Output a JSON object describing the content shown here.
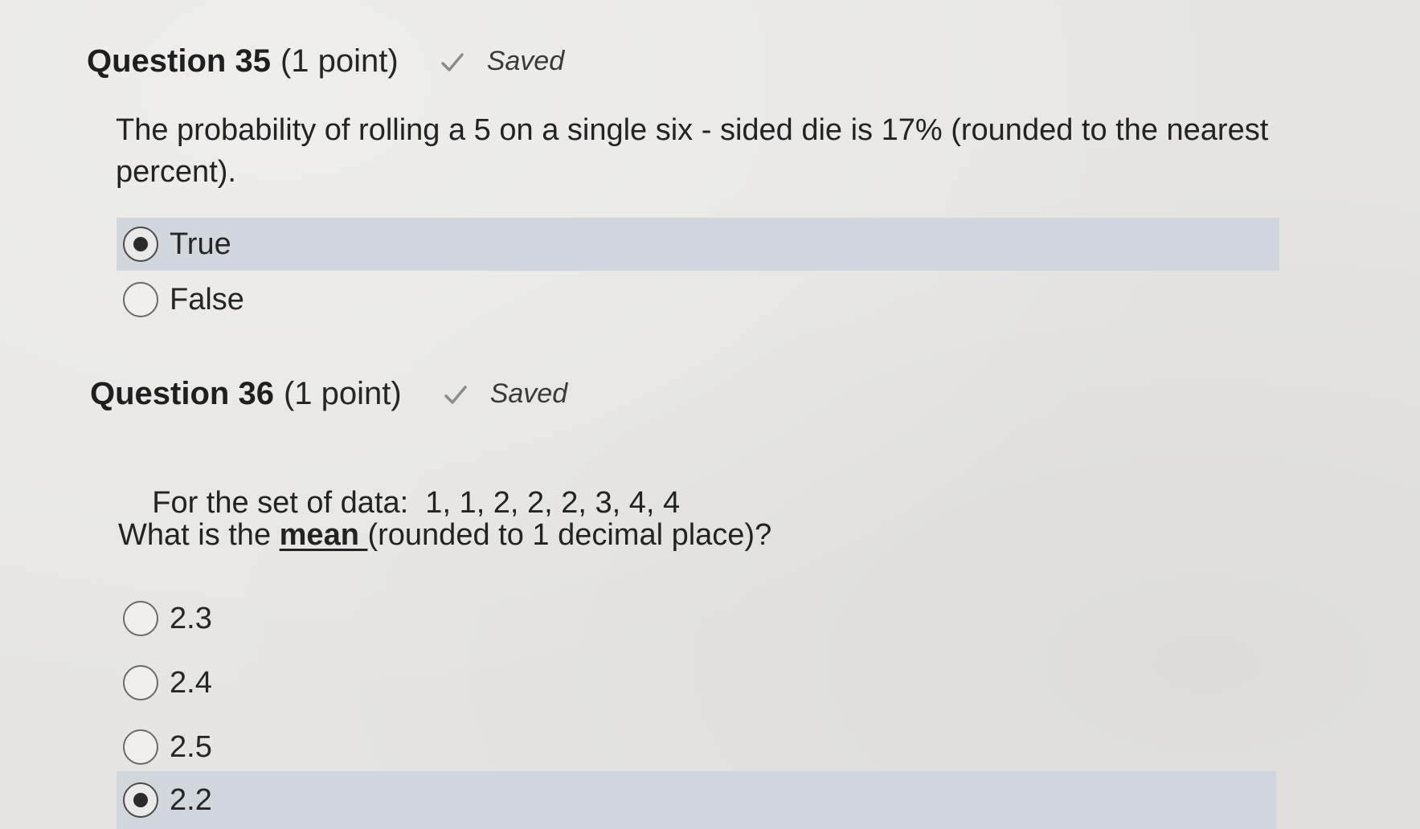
{
  "questions": [
    {
      "title": "Question 35",
      "points": "(1 point)",
      "status": "Saved",
      "status_icon": "check-icon",
      "prompt_lines": [
        "The probability of rolling a 5 on a single six - sided die is 17% (rounded to the nearest",
        "percent)."
      ],
      "options": [
        {
          "label": "True",
          "selected": true
        },
        {
          "label": "False",
          "selected": false
        }
      ]
    },
    {
      "title": "Question 36",
      "points": "(1 point)",
      "status": "Saved",
      "status_icon": "check-icon",
      "data_line": "For the set of data:  1, 1, 2, 2, 2, 3, 4, 4",
      "question_prefix": "What is the ",
      "question_emphasis": "mean ",
      "question_suffix": "(rounded to 1 decimal place)?",
      "options": [
        {
          "label": "2.3",
          "selected": false
        },
        {
          "label": "2.4",
          "selected": false
        },
        {
          "label": "2.5",
          "selected": false
        },
        {
          "label": "2.2",
          "selected": true
        }
      ]
    }
  ],
  "colors": {
    "selected_highlight": "#d2d7dd",
    "background": "#e6e5e2",
    "check": "#8c8c8c"
  }
}
